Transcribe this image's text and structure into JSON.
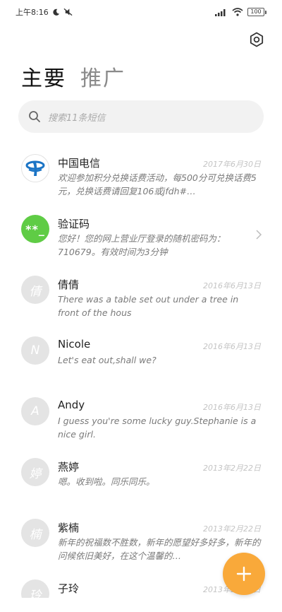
{
  "status_bar": {
    "time": "上午8:16",
    "battery": "100"
  },
  "tabs": [
    {
      "label": "主要"
    },
    {
      "label": "推广"
    }
  ],
  "search": {
    "placeholder": "搜索11条短信"
  },
  "conversations": [
    {
      "name": "中国电信",
      "date": "2017年6月30日",
      "preview": "欢迎参加积分兑换话费活动，每500分可兑换话费5元，兑换话费请回复106或jfdh#…",
      "avatar": "logo"
    },
    {
      "name": "验证码",
      "date": "",
      "preview": "您好！您的网上营业厅登录的随机密码为：710679。有效时间为3分钟",
      "avatar_text": "**_",
      "avatar": "green"
    },
    {
      "name": "倩倩",
      "date": "2016年6月13日",
      "preview": "There was a table set out under a tree in front of the hous",
      "avatar_text": "倩",
      "avatar": "gray"
    },
    {
      "name": "Nicole",
      "date": "2016年6月13日",
      "preview": "Let's eat out,shall we?",
      "avatar_text": "N",
      "avatar": "gray"
    },
    {
      "name": "Andy",
      "date": "2016年6月13日",
      "preview": "I guess you're some lucky guy.Stephanie is a nice girl.",
      "avatar_text": "A",
      "avatar": "gray"
    },
    {
      "name": "燕婷",
      "date": "2013年2月22日",
      "preview": "嗯。收到啦。同乐同乐。",
      "avatar_text": "婷",
      "avatar": "gray"
    },
    {
      "name": "紫楠",
      "date": "2013年2月22日",
      "preview": "新年的祝福数不胜数，新年的愿望好多好多，新年的问候依旧美好，在这个温馨的…",
      "avatar_text": "楠",
      "avatar": "gray"
    },
    {
      "name": "子玲",
      "date": "2013年2月22日",
      "preview": "",
      "avatar_text": "玲",
      "avatar": "gray"
    }
  ],
  "colors": {
    "accent_fab": "#f9a93a",
    "verify_green": "#5fcc45",
    "telecom_blue": "#1b74c5"
  }
}
